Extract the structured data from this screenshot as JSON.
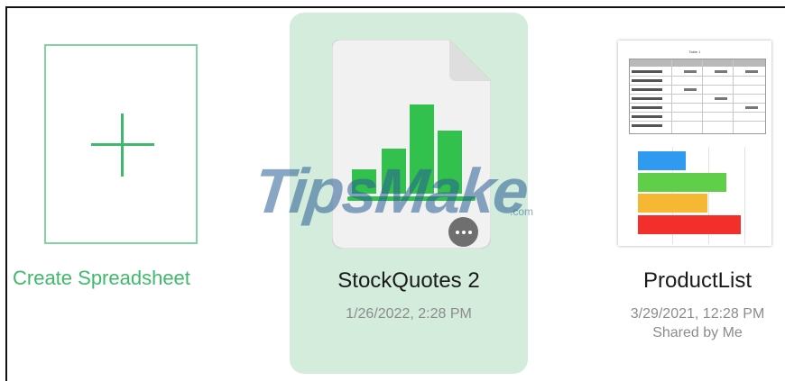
{
  "create": {
    "label": "Create Spreadsheet"
  },
  "files": [
    {
      "name": "StockQuotes 2",
      "date": "1/26/2022, 2:28 PM",
      "selected": true
    },
    {
      "name": "ProductList",
      "date": "3/29/2021, 12:28 PM",
      "shared": "Shared by Me",
      "thumbnail_title": "Table 1"
    }
  ],
  "watermark": {
    "text": "TipsMake",
    "suffix": ".com"
  },
  "colors": {
    "accent": "#3fb96b",
    "selected_bg": "#d3ecdc",
    "chart_bars": [
      "#2e9af0",
      "#5fcf4a",
      "#f6b733",
      "#f22f2a"
    ]
  }
}
